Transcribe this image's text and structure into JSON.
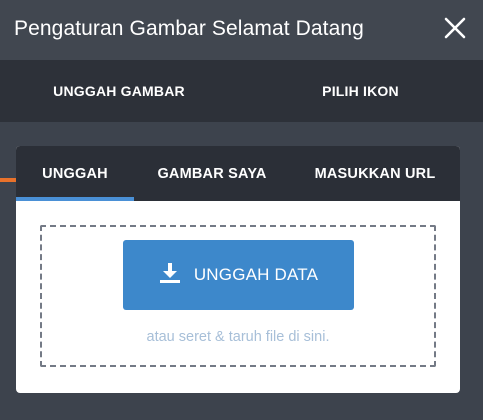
{
  "header": {
    "title": "Pengaturan Gambar Selamat Datang",
    "close_icon": "close-icon"
  },
  "main_tabs": [
    {
      "label": "UNGGAH GAMBAR",
      "active": true
    },
    {
      "label": "PILIH IKON",
      "active": false
    }
  ],
  "sub_tabs": [
    {
      "label": "UNGGAH",
      "active": true
    },
    {
      "label": "GAMBAR SAYA",
      "active": false
    },
    {
      "label": "MASUKKAN URL",
      "active": false
    }
  ],
  "dropzone": {
    "upload_button_label": "UNGGAH DATA",
    "upload_icon": "download-icon",
    "hint": "atau seret & taruh file di sini."
  },
  "colors": {
    "accent_orange": "#e9722b",
    "accent_blue": "#4a90d6",
    "button_blue": "#3d88cb"
  }
}
